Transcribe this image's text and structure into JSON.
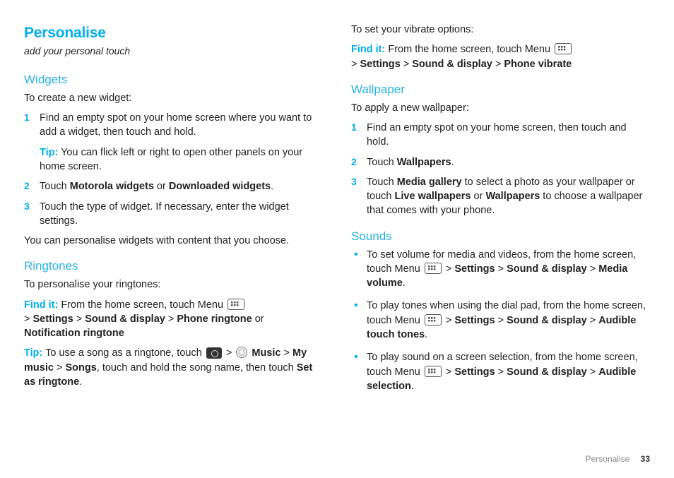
{
  "title": "Personalise",
  "subtitle": "add your personal touch",
  "widgets": {
    "heading": "Widgets",
    "intro": "To create a new widget:",
    "s1": "Find an empty spot on your home screen where you want to add a widget, then touch and hold.",
    "tip_label": "Tip:",
    "tip_text": " You can flick left or right to open other panels on your home screen.",
    "s2_a": "Touch ",
    "s2_b": "Motorola widgets",
    "s2_c": " or ",
    "s2_d": "Downloaded widgets",
    "s2_e": ".",
    "s3": "Touch the type of widget. If necessary, enter the widget settings.",
    "outro": "You can personalise widgets with content that you choose."
  },
  "ringtones": {
    "heading": "Ringtones",
    "intro": "To personalise your ringtones:",
    "findit_label": "Find it:",
    "findit_a": " From the home screen, touch Menu ",
    "path_gt": " > ",
    "p_settings": "Settings",
    "p_sd": "Sound & display",
    "p_pr": "Phone ringtone",
    "or": " or ",
    "p_nr": "Notification ringtone",
    "tip_label": "Tip:",
    "tip_a": " To use a song as a ringtone, touch ",
    "path_music": "Music",
    "path_mymusic": "My music",
    "path_songs": "Songs",
    "tip_b": ", touch and hold the song name, then touch ",
    "set_as": "Set as ringtone",
    "period": "."
  },
  "vibrate": {
    "intro": "To set your vibrate options:",
    "findit_label": "Find it:",
    "findit_a": " From the home screen, touch Menu ",
    "gt": " > ",
    "p_settings": "Settings",
    "p_sd": "Sound & display",
    "p_pv": "Phone vibrate"
  },
  "wallpaper": {
    "heading": "Wallpaper",
    "intro": "To apply a new wallpaper:",
    "s1": "Find an empty spot on your home screen, then touch and hold.",
    "s2_a": "Touch ",
    "s2_b": "Wallpapers",
    "s2_c": ".",
    "s3_a": "Touch ",
    "s3_b": "Media gallery",
    "s3_c": " to select a photo as your wallpaper or touch ",
    "s3_d": "Live wallpapers",
    "s3_e": " or ",
    "s3_f": "Wallpapers",
    "s3_g": " to choose a wallpaper that comes with your phone."
  },
  "sounds": {
    "heading": "Sounds",
    "b1_a": "To set volume for media and videos, from the home screen, touch Menu ",
    "gt": " > ",
    "p_settings": "Settings",
    "p_sd": "Sound & display",
    "p_mv": "Media volume",
    "period": ".",
    "b2_a": "To play tones when using the dial pad, from the home screen, touch Menu ",
    "p_att": "Audible touch tones",
    "b3_a": "To play sound on a screen selection, from the home screen, touch Menu ",
    "p_as": "Audible selection"
  },
  "footer": {
    "section": "Personalise",
    "page": "33"
  }
}
